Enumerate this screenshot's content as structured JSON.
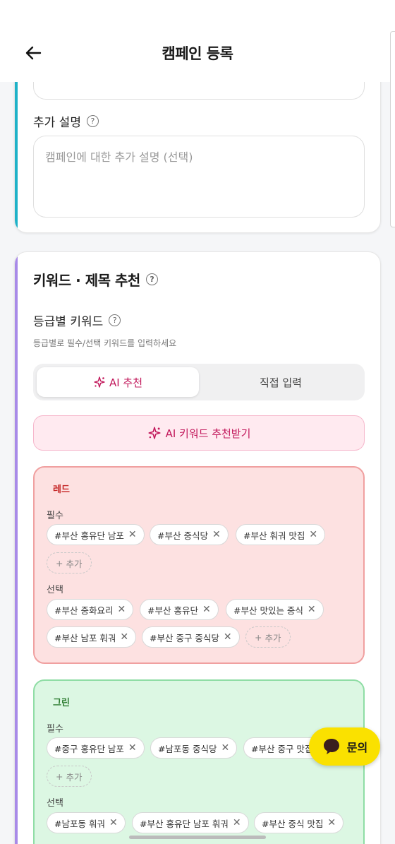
{
  "header": {
    "title": "캠페인 등록"
  },
  "card1": {
    "extra_desc_label": "추가 설명",
    "extra_desc_placeholder": "캠페인에 대한 추가 설명 (선택)"
  },
  "card2": {
    "section_title": "키워드 · 제목 추천",
    "grade_keyword_label": "등급별 키워드",
    "hint": "등급별로 필수/선택 키워드를 입력하세요",
    "seg_ai": "AI 추천",
    "seg_direct": "직접 입력",
    "ai_button": "AI 키워드 추천받기",
    "red": {
      "name": "레드",
      "required_label": "필수",
      "required": [
        "#부산 홍유단 남포",
        "#부산 중식당",
        "#부산 훠궈 맛집"
      ],
      "optional_label": "선택",
      "optional": [
        "#부산 중화요리",
        "#부산 홍유단",
        "#부산 맛있는 중식",
        "#부산 남포 훠궈",
        "#부산 중구 중식당"
      ],
      "add": "추가"
    },
    "green": {
      "name": "그린",
      "required_label": "필수",
      "required": [
        "#중구 홍유단 남포",
        "#남포동 중식당",
        "#부산 중구 맛집"
      ],
      "optional_label": "선택",
      "optional": [
        "#남포동 훠궈",
        "#부산 홍유단 남포 훠궈",
        "#부산 중식 맛집"
      ],
      "add": "추가"
    }
  },
  "fab": {
    "label": "문의"
  },
  "colors": {
    "accent_pink": "#c2185b",
    "kakao_yellow": "#fae100",
    "teal": "#1fb2c8",
    "purple": "#a88ae8"
  }
}
